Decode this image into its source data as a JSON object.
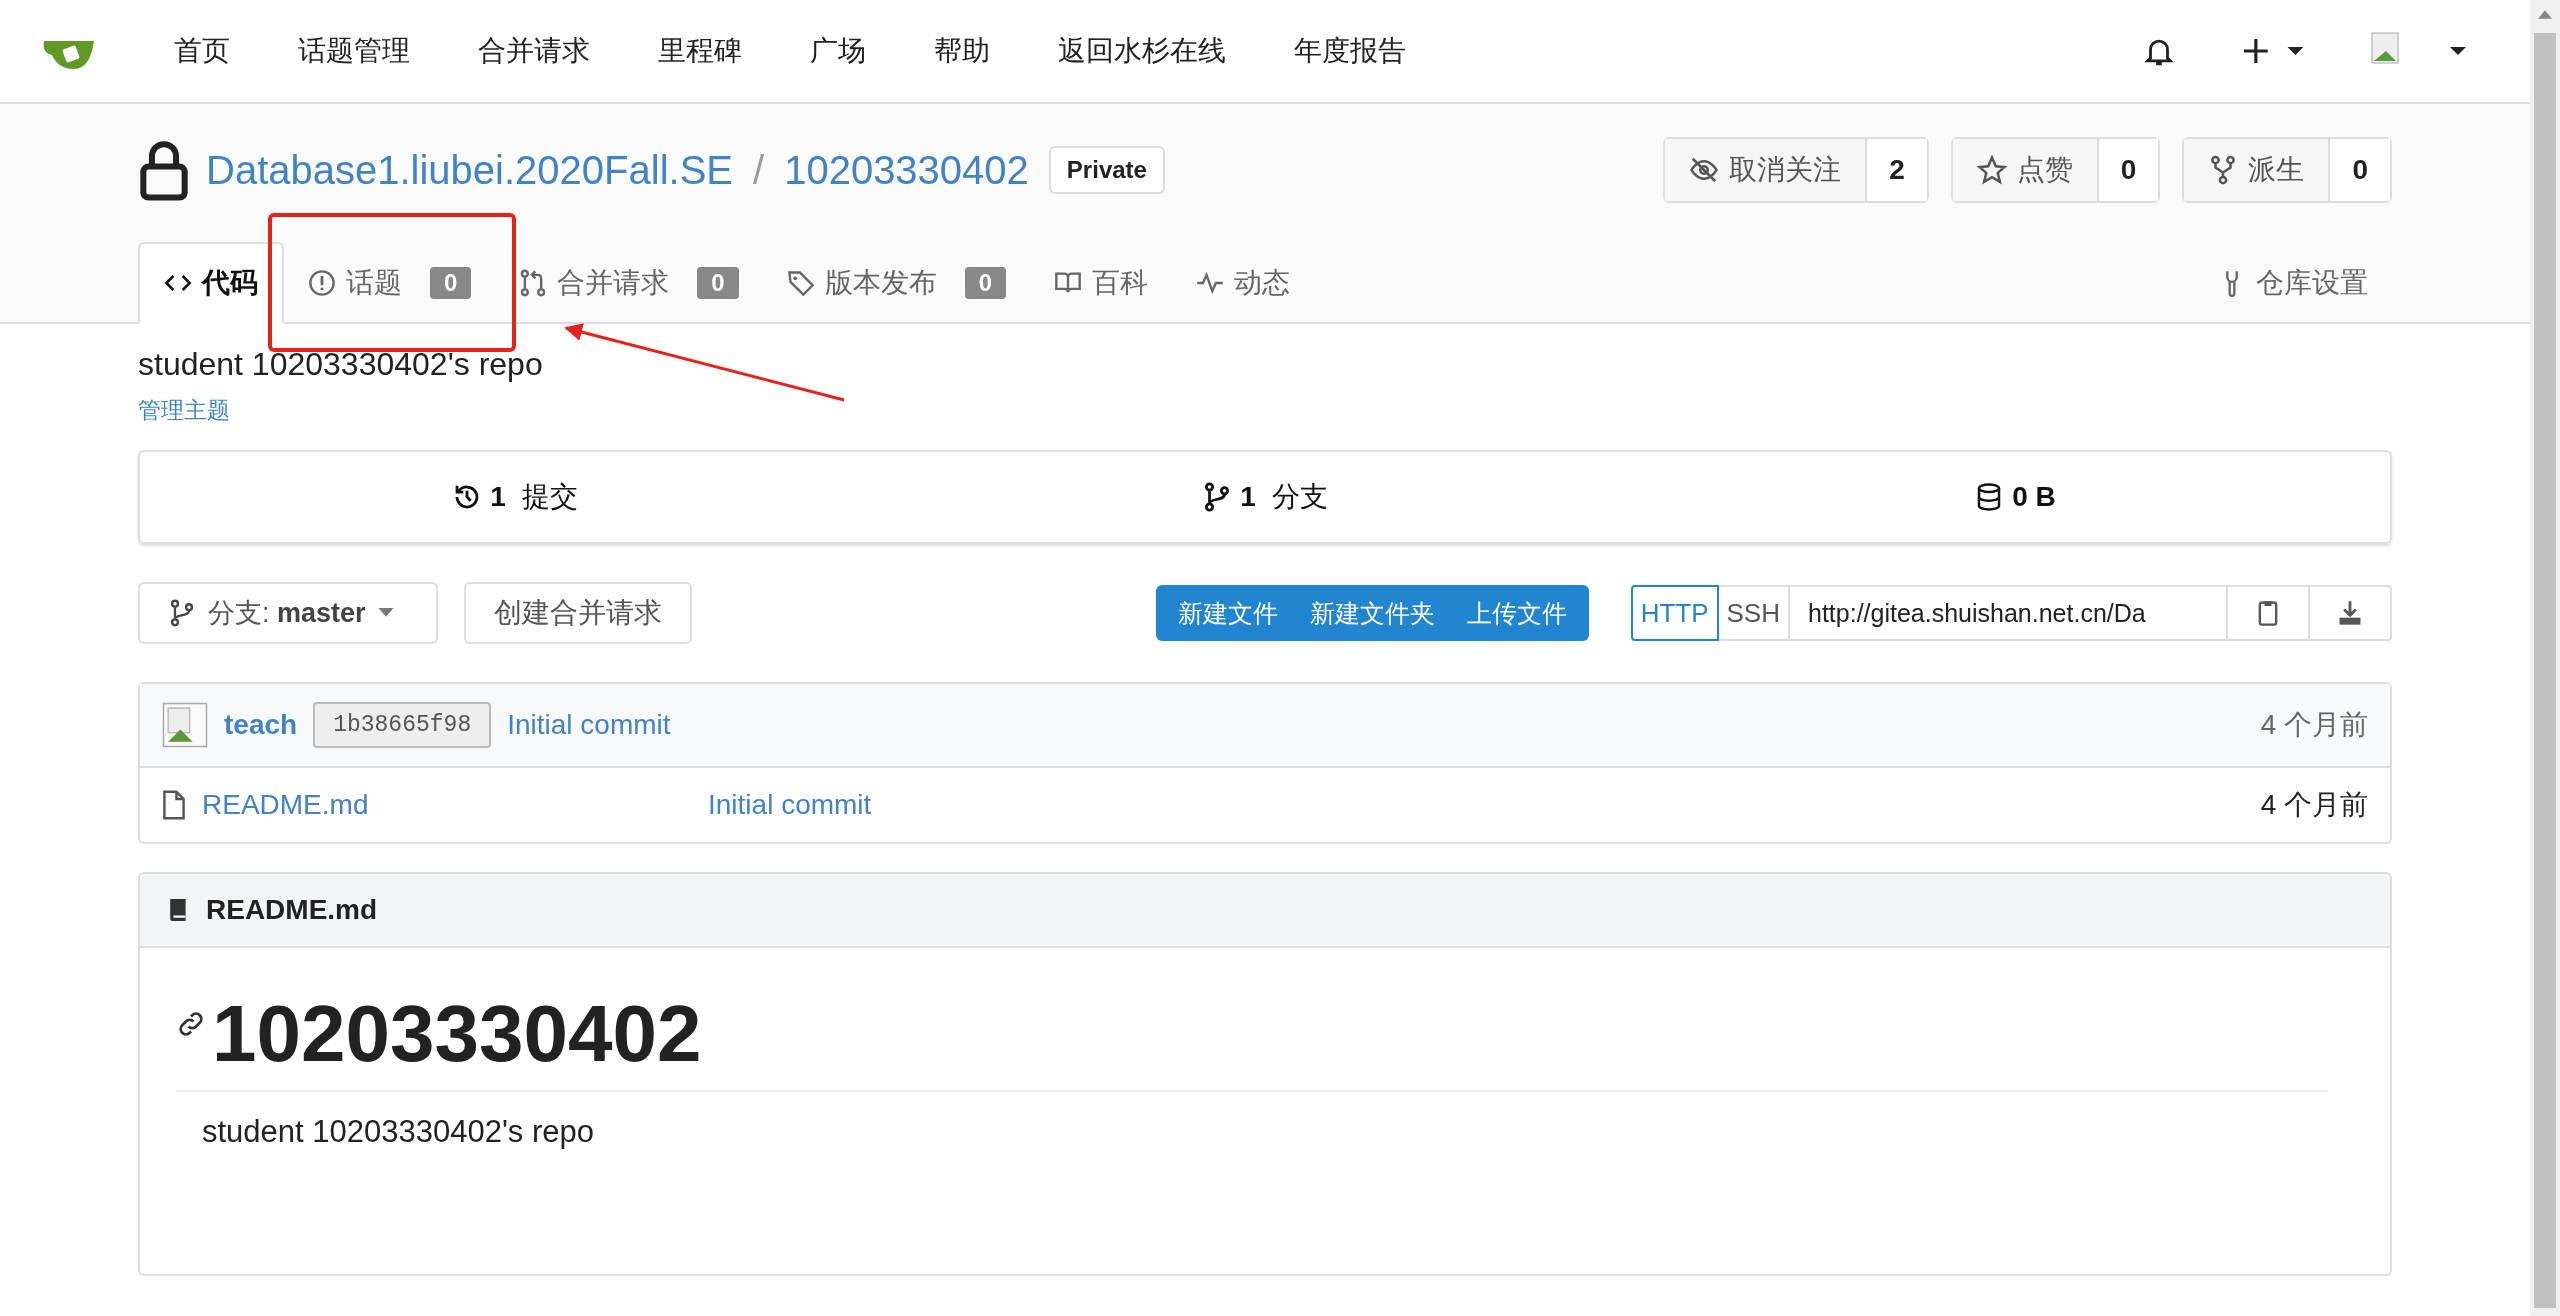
{
  "navbar": {
    "menu": [
      "首页",
      "话题管理",
      "合并请求",
      "里程碑",
      "广场",
      "帮助",
      "返回水杉在线",
      "年度报告"
    ]
  },
  "repo": {
    "owner": "Database1.liubei.2020Fall.SE",
    "separator": "/",
    "name": "10203330402",
    "visibility": "Private",
    "actions": [
      {
        "kind": "watch",
        "label": "取消关注",
        "count": "2"
      },
      {
        "kind": "star",
        "label": "点赞",
        "count": "0"
      },
      {
        "kind": "fork",
        "label": "派生",
        "count": "0"
      }
    ]
  },
  "tabs": [
    {
      "kind": "code",
      "label": "代码",
      "selected": true
    },
    {
      "kind": "issues",
      "label": "话题",
      "count": "0",
      "selected": false
    },
    {
      "kind": "pulls",
      "label": "合并请求",
      "count": "0",
      "selected": false
    },
    {
      "kind": "releases",
      "label": "版本发布",
      "count": "0",
      "selected": false
    },
    {
      "kind": "wiki",
      "label": "百科",
      "selected": false
    },
    {
      "kind": "activity",
      "label": "动态",
      "selected": false
    }
  ],
  "settings_tab": "仓库设置",
  "description": "student 10203330402's repo",
  "manage_topics": "管理主题",
  "stats": [
    {
      "kind": "commits",
      "count": "1",
      "label": "提交"
    },
    {
      "kind": "branches",
      "count": "1",
      "label": "分支"
    },
    {
      "kind": "size",
      "count": "0 B"
    }
  ],
  "branch": {
    "prefix": "分支:",
    "name": "master"
  },
  "create_pr": "创建合并请求",
  "file_buttons": [
    "新建文件",
    "新建文件夹",
    "上传文件"
  ],
  "clone": {
    "protocols": [
      {
        "label": "HTTP",
        "selected": true
      },
      {
        "label": "SSH",
        "selected": false
      }
    ],
    "url": "http://gitea.shuishan.net.cn/Da"
  },
  "latest_commit": {
    "author": "teach",
    "sha": "1b38665f98",
    "message": "Initial commit",
    "time": "4 个月前"
  },
  "files": [
    {
      "name": "README.md",
      "message": "Initial commit",
      "time": "4 个月前"
    }
  ],
  "readme": {
    "filename": "README.md",
    "heading": "10203330402",
    "text": "student 10203330402's repo"
  }
}
